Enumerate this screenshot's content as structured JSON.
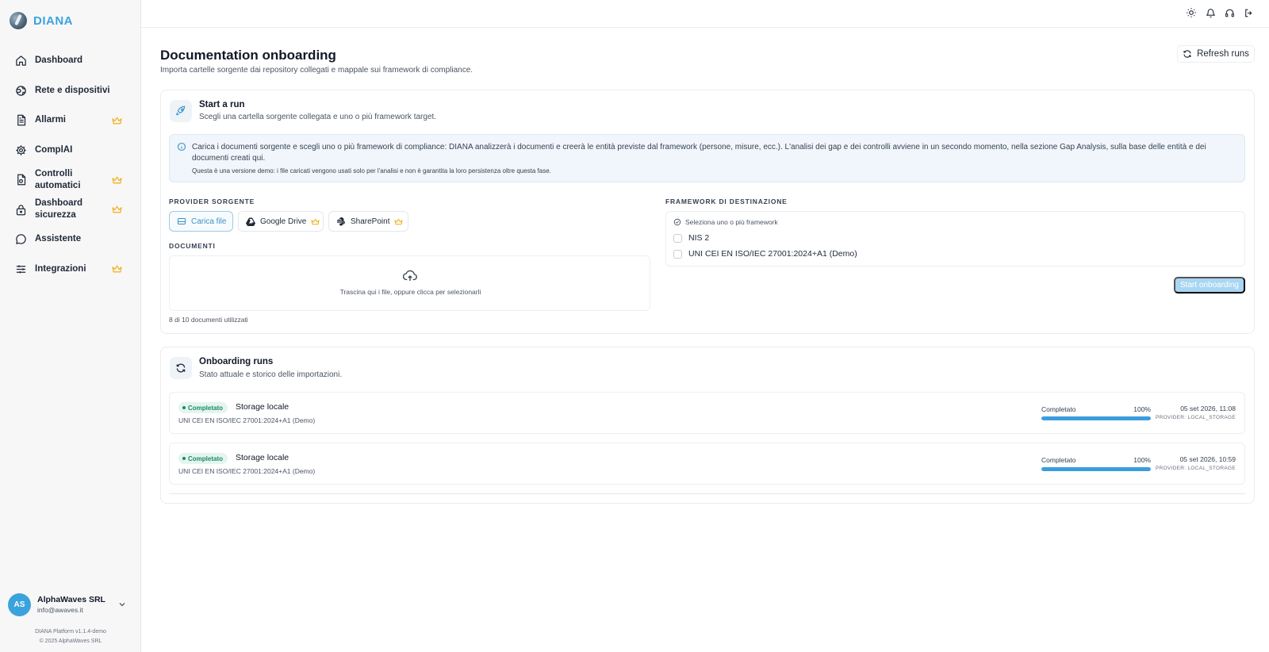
{
  "app": {
    "name": "DIANA"
  },
  "sidebar": {
    "items": [
      {
        "label": "Dashboard",
        "icon": "home-icon",
        "premium": false
      },
      {
        "label": "Rete e dispositivi",
        "icon": "network-icon",
        "premium": false
      },
      {
        "label": "Allarmi",
        "icon": "document-icon",
        "premium": true
      },
      {
        "label": "ComplAI",
        "icon": "gear-icon",
        "premium": false
      },
      {
        "label": "Controlli automatici",
        "icon": "file-check-icon",
        "premium": true
      },
      {
        "label": "Dashboard sicurezza",
        "icon": "lock-icon",
        "premium": true
      },
      {
        "label": "Assistente",
        "icon": "chat-icon",
        "premium": false
      },
      {
        "label": "Integrazioni",
        "icon": "sliders-icon",
        "premium": true
      }
    ],
    "user": {
      "initials": "AS",
      "name": "AlphaWaves SRL",
      "email": "info@awaves.it"
    },
    "footer": {
      "version": "DIANA Platform v1.1.4-demo",
      "copyright": "© 2025 AlphaWaves SRL"
    }
  },
  "topbar": {
    "icons": [
      "sun-icon",
      "bell-icon",
      "headset-icon",
      "logout-icon"
    ]
  },
  "page": {
    "title": "Documentation onboarding",
    "subtitle": "Importa cartelle sorgente dai repository collegati e mappale sui framework di compliance.",
    "refresh_label": "Refresh runs"
  },
  "start_run": {
    "title": "Start a run",
    "subtitle": "Scegli una cartella sorgente collegata e uno o più framework target.",
    "info_text": "Carica i documenti sorgente e scegli uno o più framework di compliance: DIANA analizzerà i documenti e creerà le entità previste dal framework (persone, misure, ecc.). L'analisi dei gap e dei controlli avviene in un secondo momento, nella sezione Gap Analysis, sulla base delle entità e dei documenti creati qui.",
    "info_note": "Questa è una versione demo: i file caricati vengono usati solo per l'analisi e non è garantita la loro persistenza oltre questa fase.",
    "provider_label": "PROVIDER SORGENTE",
    "providers": [
      {
        "label": "Carica file",
        "active": true,
        "premium": false
      },
      {
        "label": "Google Drive",
        "active": false,
        "premium": true
      },
      {
        "label": "SharePoint",
        "active": false,
        "premium": true
      }
    ],
    "documents_label": "DOCUMENTI",
    "dropzone_text": "Trascina qui i file, oppure clicca per selezionarli",
    "doc_count": "8 di 10 documenti utilizzati",
    "framework_label": "FRAMEWORK DI DESTINAZIONE",
    "framework_hint": "Seleziona uno o più framework",
    "frameworks": [
      {
        "label": "NIS 2",
        "checked": false
      },
      {
        "label": "UNI CEI EN ISO/IEC 27001:2024+A1 (Demo)",
        "checked": false
      }
    ],
    "start_label": "Start onboarding"
  },
  "runs": {
    "title": "Onboarding runs",
    "subtitle": "Stato attuale e storico delle importazioni.",
    "items": [
      {
        "status": "Completato",
        "title": "Storage locale",
        "framework": "UNI CEI EN ISO/IEC 27001:2024+A1 (Demo)",
        "progress_label": "Completato",
        "progress_pct": "100%",
        "progress": 1.0,
        "date": "05 set 2026, 11:08",
        "provider": "PROVIDER: LOCAL_STORAGE"
      },
      {
        "status": "Completato",
        "title": "Storage locale",
        "framework": "UNI CEI EN ISO/IEC 27001:2024+A1 (Demo)",
        "progress_label": "Completato",
        "progress_pct": "100%",
        "progress": 1.0,
        "date": "05 set 2026, 10:59",
        "provider": "PROVIDER: LOCAL_STORAGE"
      }
    ]
  },
  "colors": {
    "accent": "#3aa3dc",
    "crown": "#f0b429",
    "success": "#1b8a63"
  }
}
